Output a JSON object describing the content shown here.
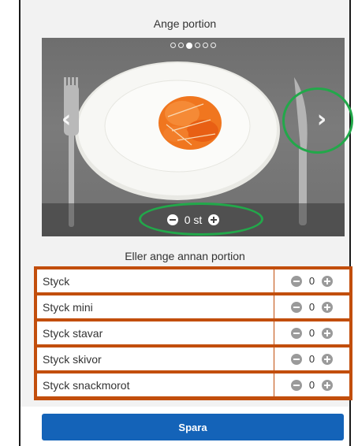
{
  "header": {
    "title": "Ange portion"
  },
  "carousel": {
    "total_slides": 6,
    "active_slide": 3,
    "image_icon": "plate-with-carrot-icon",
    "prev_icon": "chevron-left-icon",
    "next_icon": "chevron-right-icon",
    "portion": {
      "value": "0",
      "unit": "st",
      "minus_icon": "minus-circle-icon",
      "plus_icon": "plus-circle-icon"
    }
  },
  "other_portion": {
    "title": "Eller ange annan portion",
    "rows": [
      {
        "label": "Styck",
        "value": "0"
      },
      {
        "label": "Styck mini",
        "value": "0"
      },
      {
        "label": "Styck stavar",
        "value": "0"
      },
      {
        "label": "Styck skivor",
        "value": "0"
      },
      {
        "label": "Styck snackmorot",
        "value": "0"
      }
    ]
  },
  "footer": {
    "save_label": "Spara"
  },
  "colors": {
    "highlight_green": "#22a84a",
    "highlight_orange": "#c24e0c",
    "primary_blue": "#1463b8"
  }
}
